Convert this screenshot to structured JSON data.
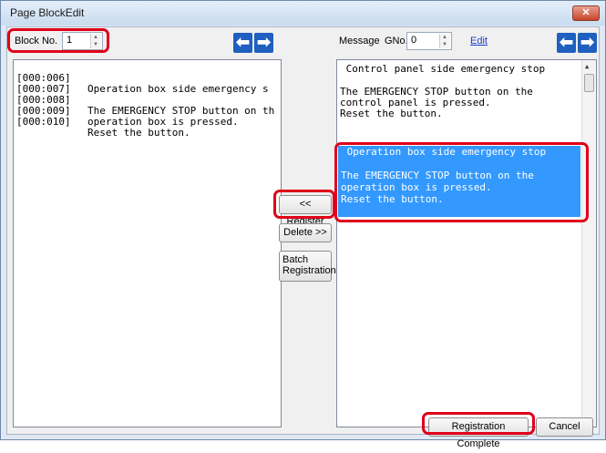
{
  "window": {
    "title": "Page BlockEdit",
    "close_glyph": "✕"
  },
  "left": {
    "block_label": "Block No.",
    "block_value": "1",
    "lines": [
      {
        "prefix": "[000:006]",
        "text": "Operation box side emergency s"
      },
      {
        "prefix": "[000:007]",
        "text": ""
      },
      {
        "prefix": "[000:008]",
        "text": "The EMERGENCY STOP button on th"
      },
      {
        "prefix": "[000:009]",
        "text": "operation box is pressed."
      },
      {
        "prefix": "[000:010]",
        "text": "Reset the button."
      }
    ]
  },
  "right": {
    "message_label": "Message",
    "gno_label": "GNo.",
    "gno_value": "0",
    "edit_link": "Edit",
    "lines": [
      " Control panel side emergency stop",
      "",
      "The EMERGENCY STOP button on the",
      "control panel is pressed.",
      "Reset the button."
    ],
    "selected_lines": [
      " Operation box side emergency stop",
      "",
      "The EMERGENCY STOP button on the",
      "operation box is pressed.",
      "Reset the button."
    ]
  },
  "middle": {
    "register_label": "<< Register",
    "delete_label": "Delete >>",
    "batch_line1": "Batch",
    "batch_line2": "Registration"
  },
  "footer": {
    "complete_label": "Registration Complete",
    "cancel_label": "Cancel"
  },
  "icons": {
    "arrow_left": "left-arrow-icon",
    "arrow_right": "right-arrow-icon"
  },
  "colors": {
    "highlight": "#e0001a",
    "selection": "#3399ff",
    "nav_arrow": "#1f5fbf"
  }
}
